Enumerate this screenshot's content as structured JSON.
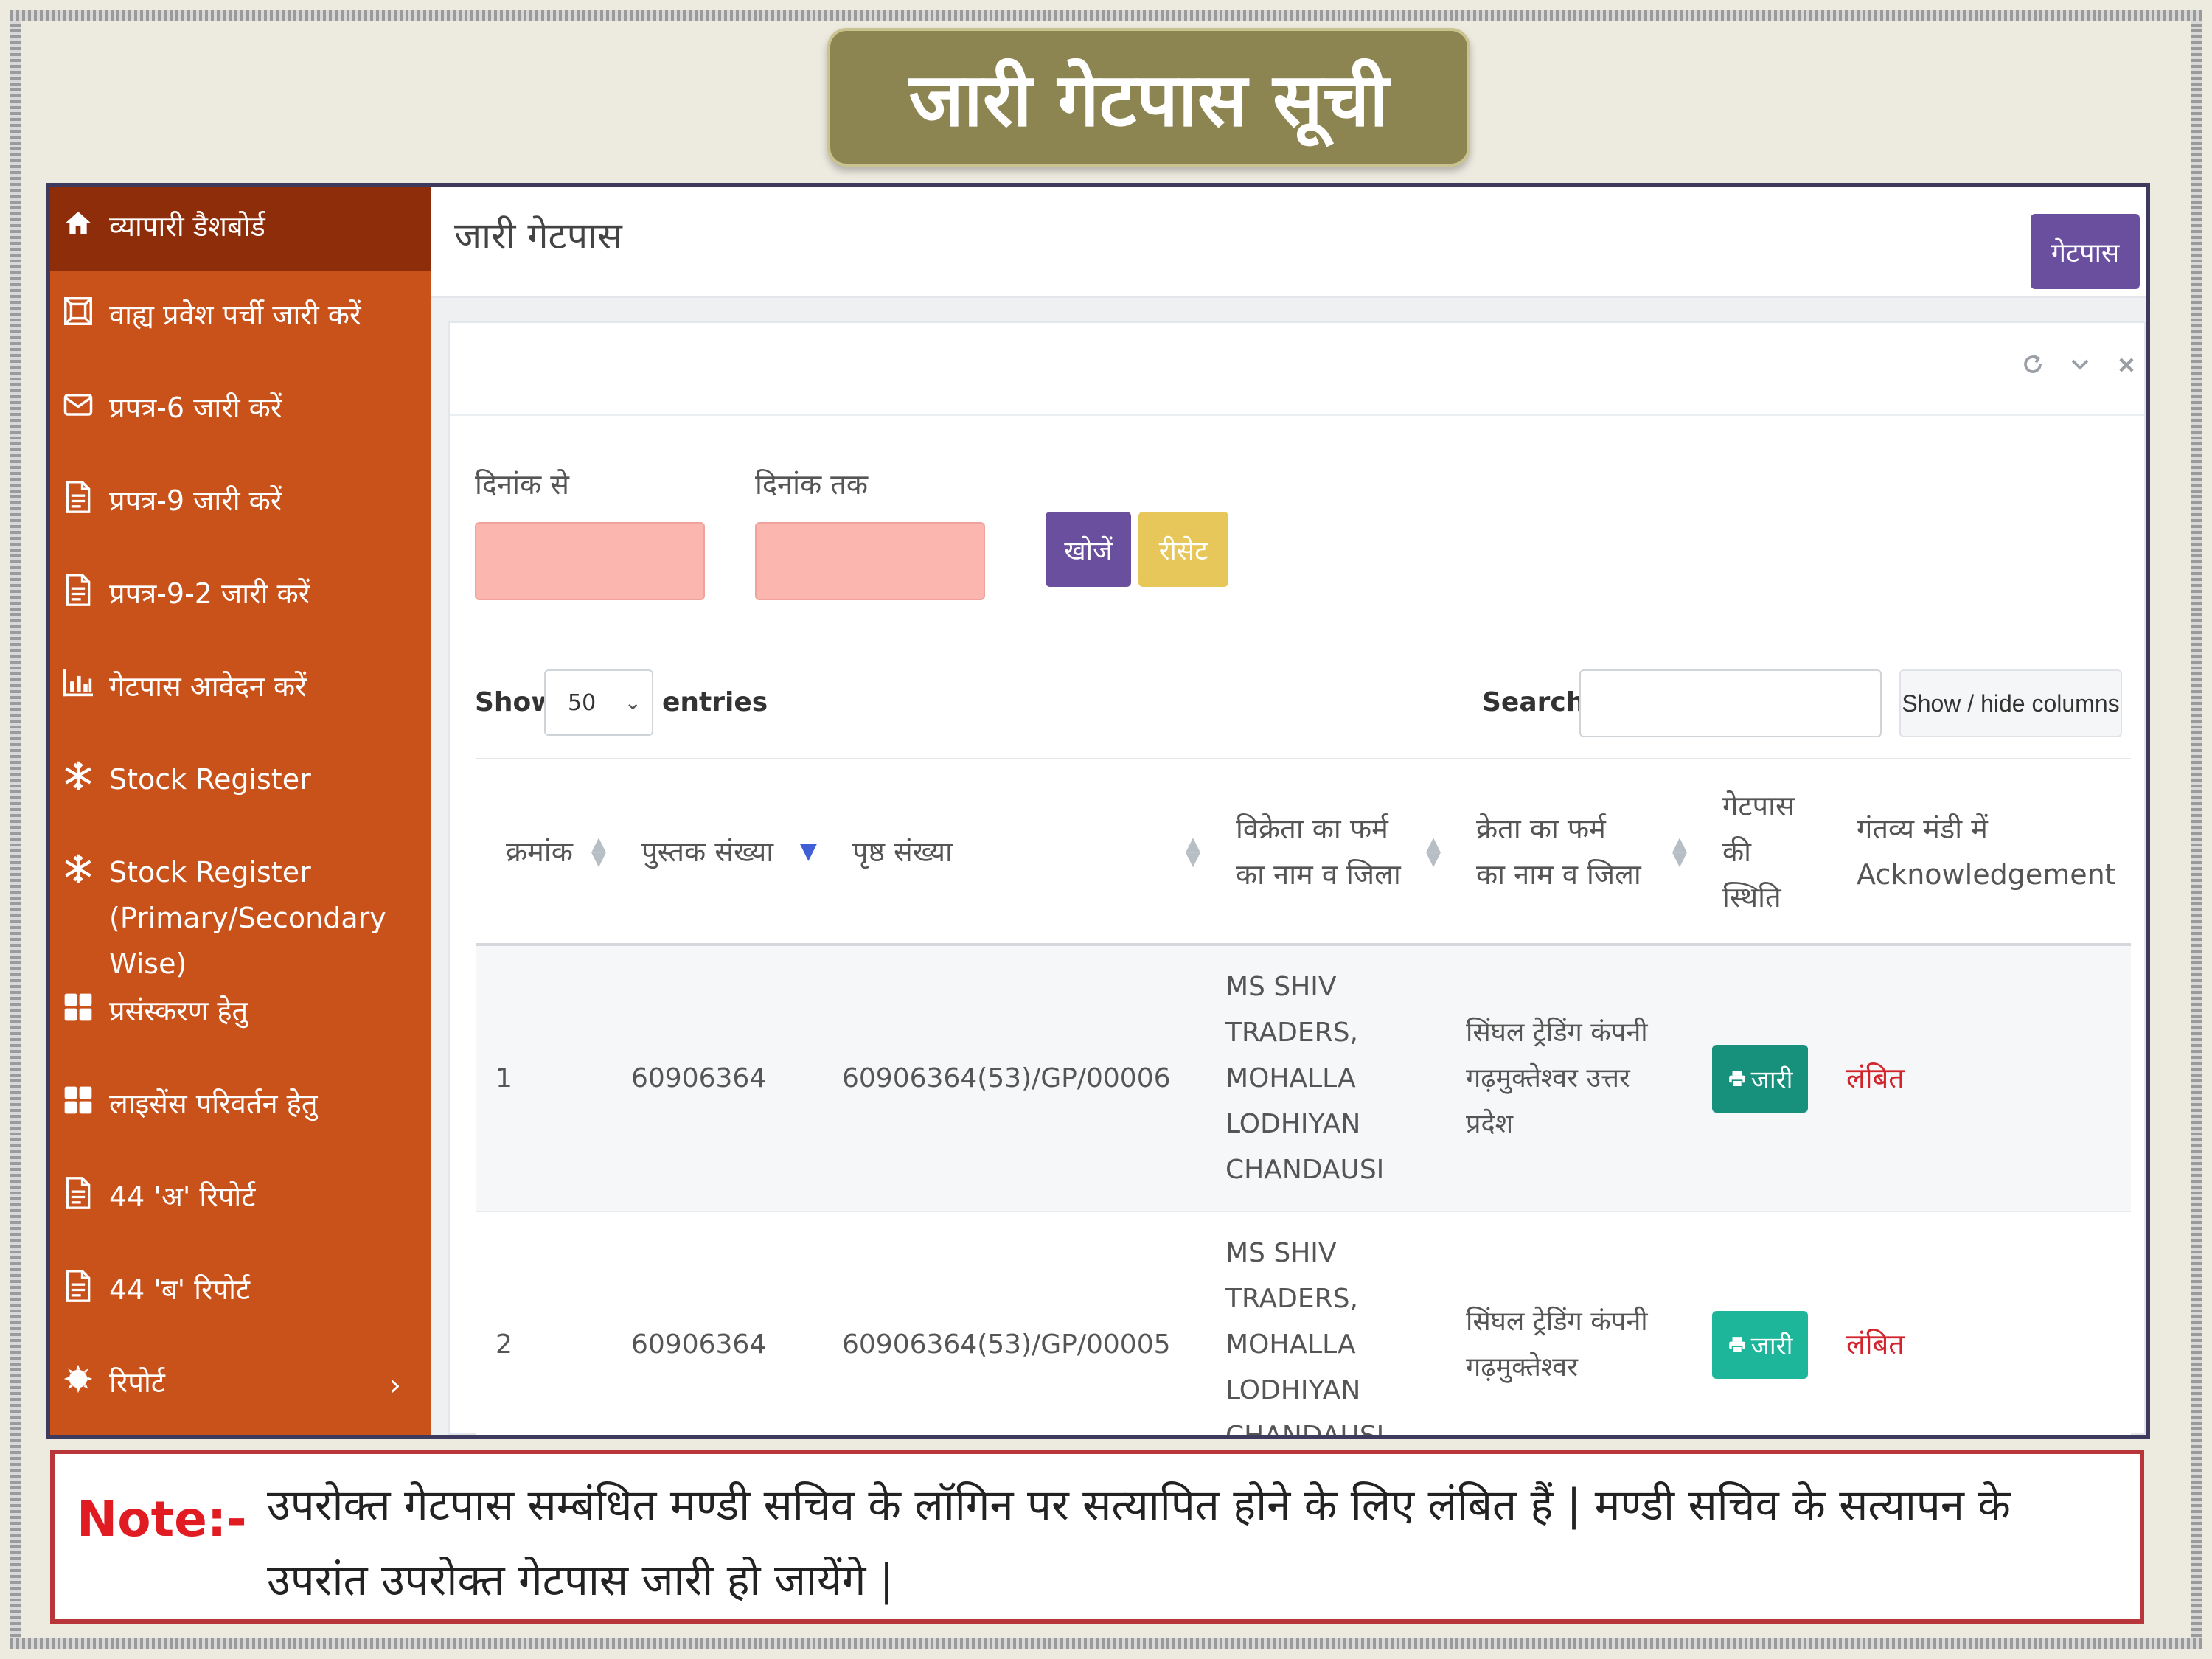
{
  "banner": {
    "title": "जारी गेटपास सूची"
  },
  "sidebar": {
    "items": [
      {
        "label": "व्यापारी डैशबोर्ड",
        "icon": "home-icon"
      },
      {
        "label": "वाह्य प्रवेश पर्ची जारी करें",
        "icon": "form-icon"
      },
      {
        "label": "प्रपत्र-6 जारी करें",
        "icon": "envelope-icon"
      },
      {
        "label": "प्रपत्र-9 जारी करें",
        "icon": "document-icon"
      },
      {
        "label": "प्रपत्र-9-2 जारी करें",
        "icon": "document-icon"
      },
      {
        "label": "गेटपास आवेदन करें",
        "icon": "bar-chart-icon"
      },
      {
        "label": "Stock Register",
        "icon": "snowflake-icon"
      },
      {
        "label": "Stock Register",
        "label2": "(Primary/Secondary Wise)",
        "icon": "snowflake-icon"
      },
      {
        "label": "प्रसंस्करण हेतु",
        "icon": "grid-icon"
      },
      {
        "label": "लाइसेंस परिवर्तन हेतु",
        "icon": "grid-icon"
      },
      {
        "label": "44 'अ' रिपोर्ट",
        "icon": "document-icon"
      },
      {
        "label": "44 'ब' रिपोर्ट",
        "icon": "document-icon"
      },
      {
        "label": "रिपोर्ट",
        "icon": "gear-icon",
        "chevron": "›"
      }
    ]
  },
  "header": {
    "title": "जारी गेटपास",
    "gatepass_button": "गेटपास"
  },
  "filters": {
    "from_label": "दिनांक से",
    "to_label": "दिनांक तक",
    "search_button": "खोजें",
    "reset_button": "रीसेट"
  },
  "table_controls": {
    "show_label": "Show",
    "entries_value": "50",
    "entries_label": "entries",
    "search_label": "Search:",
    "colvis_button": "Show / hide columns"
  },
  "table": {
    "headers": {
      "serial": "क्रमांक",
      "book_no": "पुस्तक संख्या",
      "page_no": "पृष्ठ संख्या",
      "seller_1": "विक्रेता का फर्म",
      "seller_2": "का नाम व जिला",
      "buyer_1": "क्रेता का फर्म",
      "buyer_2": "का नाम व जिला",
      "status_1": "गेटपास",
      "status_2": "की",
      "status_3": "स्थिति",
      "ack_1": "गंतव्य मंडी में",
      "ack_2": "Acknowledgement"
    },
    "rows": [
      {
        "serial": "1",
        "book_no": "60906364",
        "page_no": "60906364(53)/GP/00006",
        "seller": [
          "MS SHIV",
          "TRADERS,",
          "MOHALLA",
          "LODHIYAN",
          "CHANDAUSI"
        ],
        "buyer": [
          "सिंघल ट्रेडिंग कंपनी",
          "गढ़मुक्तेश्वर उत्तर प्रदेश"
        ],
        "status_button": "जारी",
        "ack": "लंबित"
      },
      {
        "serial": "2",
        "book_no": "60906364",
        "page_no": "60906364(53)/GP/00005",
        "seller": [
          "MS SHIV",
          "TRADERS,",
          "MOHALLA",
          "LODHIYAN",
          "CHANDAUSI"
        ],
        "buyer": [
          "सिंघल ट्रेडिंग कंपनी",
          "गढ़मुक्तेश्वर"
        ],
        "status_button": "जारी",
        "ack": "लंबित"
      }
    ]
  },
  "note": {
    "label": "Note:-",
    "text": "उपरोक्त गेटपास सम्बंधित  मण्डी सचिव के लॉगिन पर सत्यापित होने के लिए लंबित हैं | मण्डी सचिव के सत्यापन के उपरांत उपरोक्त गेटपास जारी हो जायेंगे |"
  },
  "colors": {
    "sidebar": "#c9511a",
    "sidebar_active": "#8e2d09",
    "banner": "#8c8552",
    "primary_button": "#6a4f9e",
    "reset_button": "#e8c75a",
    "date_input": "#fbb6b0",
    "issue_button": "#17907c",
    "pending_text": "#d1242c",
    "note_border": "#b8353a"
  }
}
